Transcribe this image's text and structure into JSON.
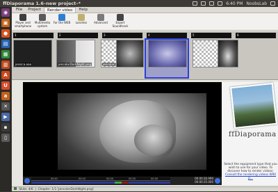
{
  "topbar": {
    "title": "ffDiaporama 1.6–new project–*",
    "time": "6:40 PM",
    "user": "NoobsLab"
  },
  "menu": {
    "tabs": [
      "File",
      "Project",
      "Render video",
      "Help"
    ],
    "active_index": 2
  },
  "toolbar": [
    {
      "label": "Player and smartphone",
      "icon": "player-icon",
      "color": "#3e3e3e"
    },
    {
      "label": "Multimedia system",
      "icon": "multimedia-icon",
      "color": "#5a5a5a"
    },
    {
      "label": "For the WEB",
      "icon": "web-icon",
      "color": "#2e7fd1"
    },
    {
      "label": "Lossless",
      "icon": "lossless-icon",
      "color": "#c0b070"
    },
    {
      "label": "Advanced",
      "icon": "advanced-icon",
      "color": "#7a7a7a"
    },
    {
      "label": "Export Soundtrack",
      "icon": "soundtrack-icon",
      "color": "#444"
    }
  ],
  "timeline": {
    "segments": [
      "1",
      "2",
      "3",
      "4",
      "5",
      "6"
    ],
    "slides": [
      {
        "caption": "jessica.ooo",
        "style": "dark"
      },
      {
        "caption": "jencolorDarkNight.png",
        "style": "mixed"
      },
      {
        "caption": "jencolorDarkNight.png",
        "style": "checker"
      },
      {
        "caption": "",
        "style": "photo"
      },
      {
        "caption": "",
        "style": "selected"
      },
      {
        "caption": "",
        "style": "checker"
      }
    ]
  },
  "preview": {
    "ticks": [
      "00:01",
      "00:10",
      "00:20",
      "00:25",
      "00:30"
    ],
    "time_current": "00:00:26.990",
    "time_total": "00:00:35.000"
  },
  "side": {
    "logo": "ffDiaporama",
    "help_text": "Select the equipment type that you wish to use for your video. To discover how to render videos:",
    "help_link": "Consult the rendering videos WIKI p..."
  },
  "status": {
    "slide": "Slide: 4/6",
    "chapter": "Chapter: 1/1 [jencolorDarkNight.png]"
  }
}
